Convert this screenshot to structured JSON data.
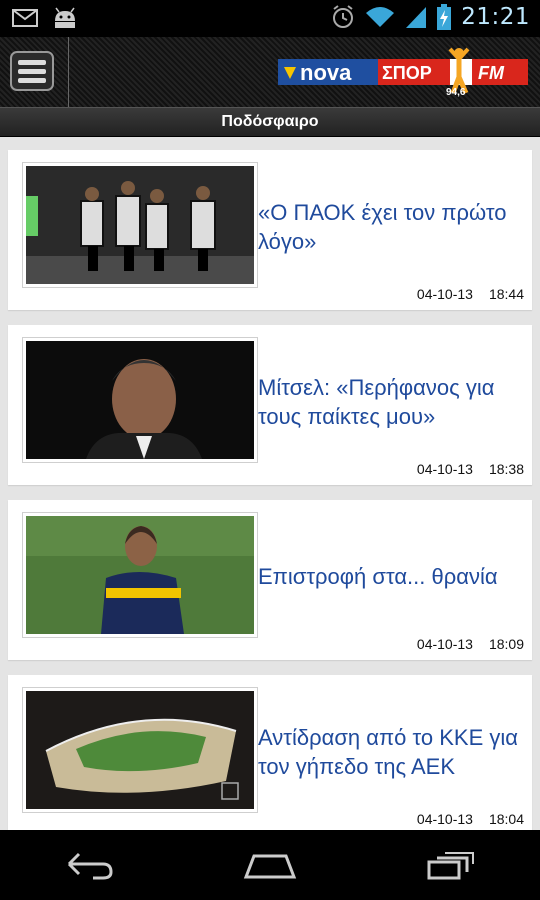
{
  "status_bar": {
    "time": "21:21",
    "icons": [
      "gmail-icon",
      "android-icon",
      "alarm-icon",
      "wifi-icon",
      "signal-icon",
      "battery-charging-icon"
    ]
  },
  "header": {
    "menu_icon": "menu-icon",
    "logo": {
      "nova": "nova",
      "sport": "ΣΠΟΡ",
      "fm": "FM",
      "freq": "94,6"
    }
  },
  "section": {
    "title": "Ποδόσφαιρο"
  },
  "articles": [
    {
      "title": "«Ο ΠΑΟΚ έχει τον πρώτο λόγο»",
      "date": "04-10-13",
      "time": "18:44"
    },
    {
      "title": "Μίτσελ: «Περήφανος για τους παίκτες μου»",
      "date": "04-10-13",
      "time": "18:38"
    },
    {
      "title": "Επιστροφή στα... θρανία",
      "date": "04-10-13",
      "time": "18:09"
    },
    {
      "title": "Αντίδραση από το ΚΚΕ για τον γήπεδο της ΑΕΚ",
      "date": "04-10-13",
      "time": "18:04"
    }
  ],
  "nav": {
    "icons": [
      "back-icon",
      "home-icon",
      "recent-apps-icon"
    ]
  }
}
